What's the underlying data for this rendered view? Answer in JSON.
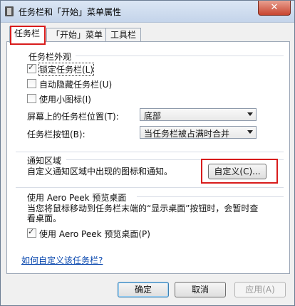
{
  "window": {
    "title": "任务栏和「开始」菜单属性",
    "close_label": "✕"
  },
  "tabs": [
    {
      "label": "任务栏"
    },
    {
      "label": "「开始」菜单"
    },
    {
      "label": "工具栏"
    }
  ],
  "appearance": {
    "group_title": "任务栏外观",
    "lock_taskbar": {
      "label": "锁定任务栏(L)",
      "checked": true
    },
    "auto_hide": {
      "label": "自动隐藏任务栏(U)",
      "checked": false
    },
    "small_icons": {
      "label": "使用小图标(I)",
      "checked": false
    },
    "location": {
      "label": "屏幕上的任务栏位置(T):",
      "value": "底部"
    },
    "buttons": {
      "label": "任务栏按钮(B):",
      "value": "当任务栏被占满时合并"
    }
  },
  "notification": {
    "group_title": "通知区域",
    "description": "自定义通知区域中出现的图标和通知。",
    "customize_label": "自定义(C)..."
  },
  "aero_peek": {
    "group_title": "使用 Aero Peek 预览桌面",
    "description": "当您将鼠标移动到任务栏末端的“显示桌面”按钮时，会暂时查看桌面。",
    "checkbox": {
      "label": "使用 Aero Peek 预览桌面(P)",
      "checked": true
    }
  },
  "help_link": "如何自定义该任务栏?",
  "footer": {
    "ok_label": "确定",
    "cancel_label": "取消",
    "apply_label": "应用(A)"
  },
  "colors": {
    "highlight": "#d81c1c",
    "link": "#0645ad"
  }
}
